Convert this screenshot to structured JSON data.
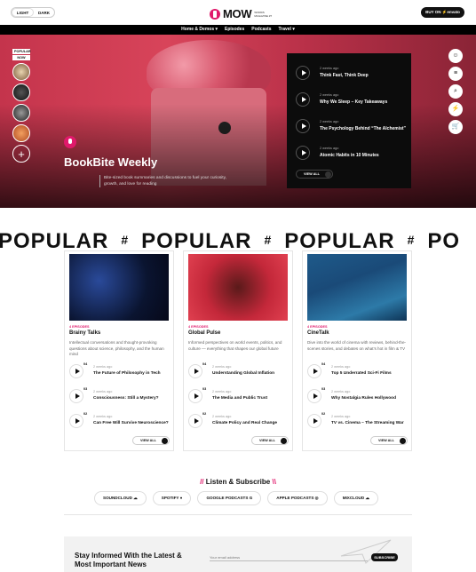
{
  "topbar": {
    "mode_light": "LIGHT",
    "mode_dark": "DARK",
    "logo": "MOW",
    "logo_sub": "WORDS MAGAZINE #7",
    "buy_label": "BUY ON ⚡envato"
  },
  "nav": [
    "Home & Demos ▾",
    "Episodes",
    "Podcasts",
    "Travel ▾"
  ],
  "hero": {
    "popular_label": "POPULAR",
    "popular_sub": "NOW",
    "title": "BookBite Weekly",
    "description": "Bite-sized book summaries and discussions to fuel your curiosity, growth, and love for reading",
    "playlist": [
      {
        "meta": "2 weeks ago",
        "title": "Think Fast, Think Deep"
      },
      {
        "meta": "2 weeks ago",
        "title": "Why We Sleep – Key Takeaways"
      },
      {
        "meta": "2 weeks ago",
        "title": "The Psychology Behind “The Alchemist”"
      },
      {
        "meta": "2 weeks ago",
        "title": "Atomic Habits in 10 Minutes"
      }
    ],
    "view_all": "VIEW ALL"
  },
  "side_icons": [
    "user-icon",
    "menu-icon",
    "search-icon",
    "bolt-icon",
    "cart-icon"
  ],
  "marquee": [
    "POPULAR",
    "#",
    "POPULAR",
    "#",
    "POPULAR",
    "#",
    "PO"
  ],
  "cards": [
    {
      "episodes": "4 EPISODES",
      "title": "Brainy Talks",
      "description": "Intellectual conversations and thought-provoking questions about science, philosophy, and the human mind",
      "items": [
        {
          "num": "04",
          "meta": "2 weeks ago",
          "title": "The Future of Philosophy in Tech"
        },
        {
          "num": "03",
          "meta": "2 weeks ago",
          "title": "Consciousness: Still a Mystery?"
        },
        {
          "num": "02",
          "meta": "2 weeks ago",
          "title": "Can Free Will Survive Neuroscience?"
        }
      ],
      "view_all": "VIEW ALL"
    },
    {
      "episodes": "4 EPISODES",
      "title": "Global Pulse",
      "description": "Informed perspectives on world events, politics, and culture — everything that shapes our global future",
      "items": [
        {
          "num": "04",
          "meta": "2 weeks ago",
          "title": "Understanding Global Inflation"
        },
        {
          "num": "03",
          "meta": "2 weeks ago",
          "title": "The Media and Public Trust"
        },
        {
          "num": "02",
          "meta": "2 weeks ago",
          "title": "Climate Policy and Real Change"
        }
      ],
      "view_all": "VIEW ALL"
    },
    {
      "episodes": "4 EPISODES",
      "title": "CineTalk",
      "description": "Dive into the world of cinema with reviews, behind-the-scenes stories, and debates on what's hot in film & TV",
      "items": [
        {
          "num": "04",
          "meta": "2 weeks ago",
          "title": "Top 5 Underrated Sci-Fi Films"
        },
        {
          "num": "03",
          "meta": "2 weeks ago",
          "title": "Why Nostalgia Rules Hollywood"
        },
        {
          "num": "02",
          "meta": "2 weeks ago",
          "title": "TV vs. Cinema – The Streaming War"
        }
      ],
      "view_all": "VIEW ALL"
    }
  ],
  "listen": {
    "title": "Listen & Subscribe",
    "left_mark": "//",
    "right_mark": "\\\\",
    "services": [
      "SOUNDCLOUD",
      "SPOTIFY",
      "GOOGLE PODCASTS",
      "APPLE PODCASTS",
      "MIXCLOUD"
    ]
  },
  "newsletter": {
    "heading": "Stay Informed With the Latest & Most Important News",
    "placeholder": "Your email address",
    "button": "SUBSCRIBE"
  },
  "colors": {
    "accent": "#e0196b",
    "dark": "#0c0c0c"
  }
}
